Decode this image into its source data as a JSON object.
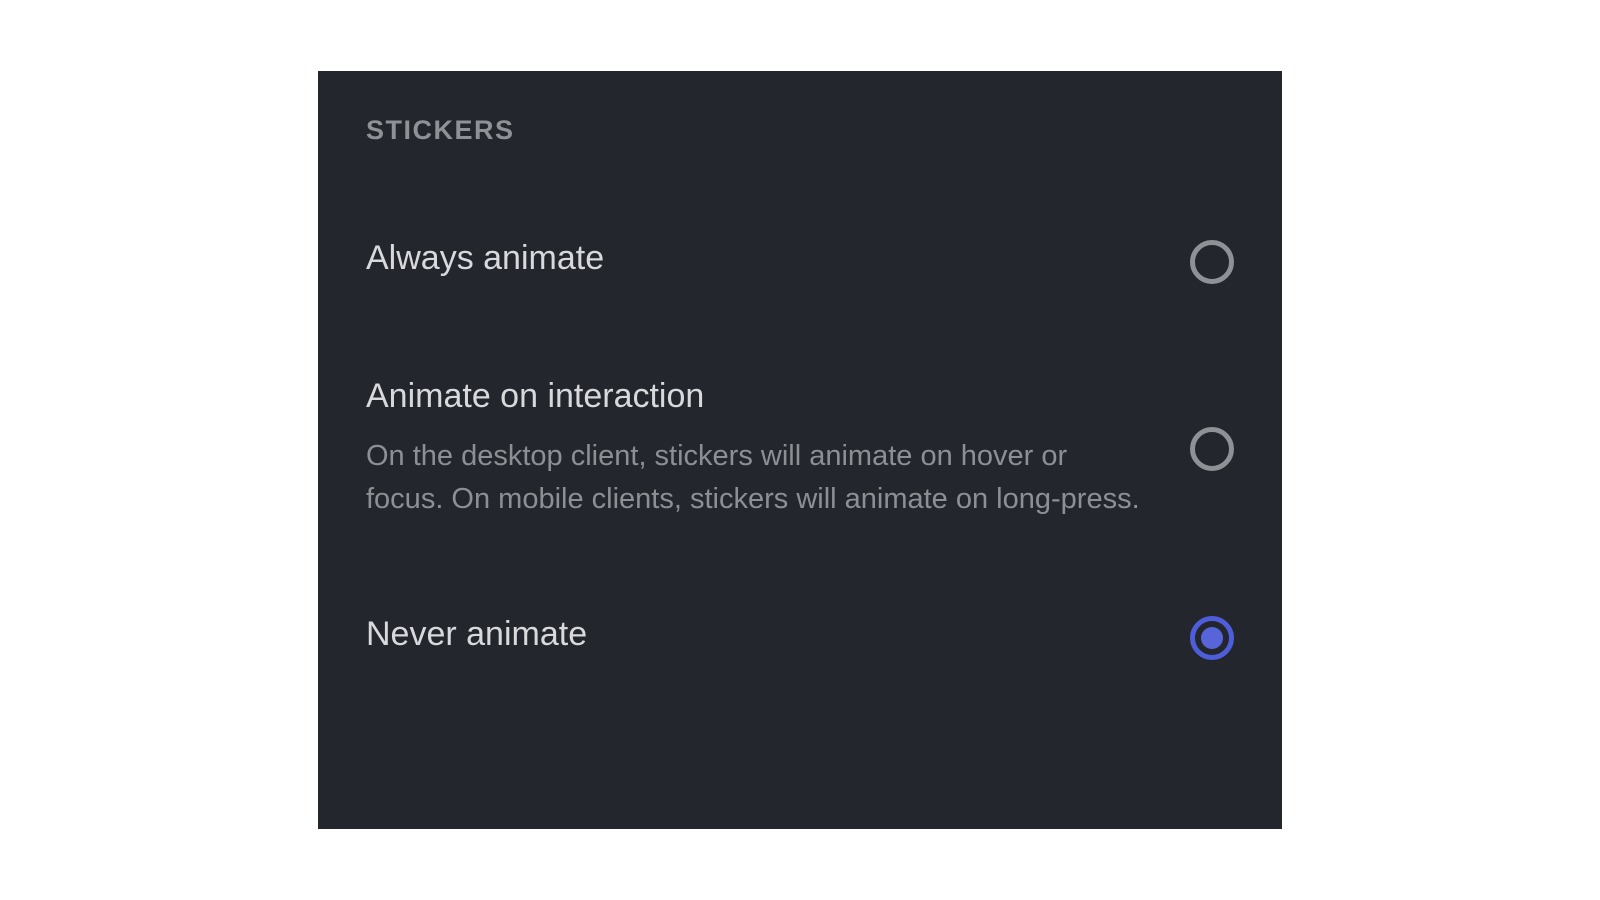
{
  "section": {
    "header": "STICKERS"
  },
  "options": [
    {
      "title": "Always animate",
      "description": "",
      "selected": false
    },
    {
      "title": "Animate on interaction",
      "description": "On the desktop client, stickers will animate on hover or focus. On mobile clients, stickers will animate on long-press.",
      "selected": false
    },
    {
      "title": "Never animate",
      "description": "",
      "selected": true
    }
  ],
  "colors": {
    "panel_bg": "#23262c",
    "text_muted": "#8e9297",
    "text_primary": "#d7d9dc",
    "text_secondary": "#8c9095",
    "accent": "#5865d9"
  }
}
